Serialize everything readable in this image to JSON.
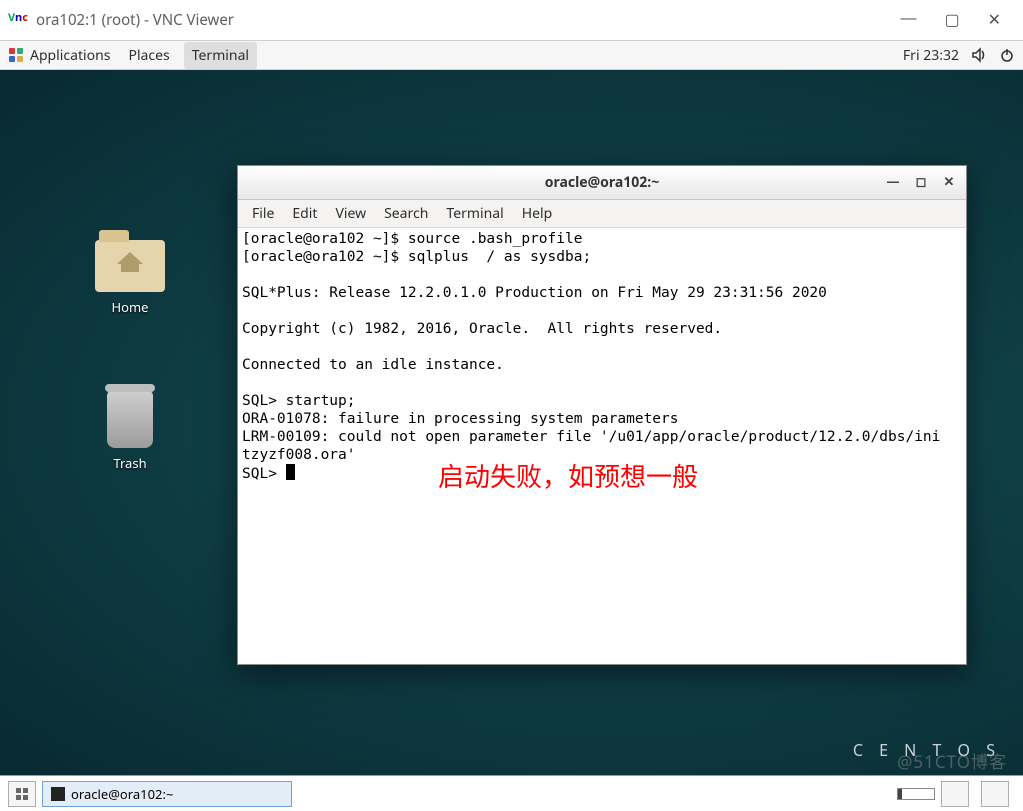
{
  "vnc": {
    "title": "ora102:1 (root) - VNC Viewer"
  },
  "topbar": {
    "applications": "Applications",
    "places": "Places",
    "terminal": "Terminal",
    "clock": "Fri 23:32"
  },
  "desktop": {
    "home_label": "Home",
    "trash_label": "Trash",
    "centos": "C E N T O S"
  },
  "termwin": {
    "title": "oracle@ora102:~",
    "menu": {
      "file": "File",
      "edit": "Edit",
      "view": "View",
      "search": "Search",
      "terminal": "Terminal",
      "help": "Help"
    }
  },
  "terminal_lines": [
    "[oracle@ora102 ~]$ source .bash_profile",
    "[oracle@ora102 ~]$ sqlplus  / as sysdba;",
    "",
    "SQL*Plus: Release 12.2.0.1.0 Production on Fri May 29 23:31:56 2020",
    "",
    "Copyright (c) 1982, 2016, Oracle.  All rights reserved.",
    "",
    "Connected to an idle instance.",
    "",
    "SQL> startup;",
    "ORA-01078: failure in processing system parameters",
    "LRM-00109: could not open parameter file '/u01/app/oracle/product/12.2.0/dbs/ini",
    "tzyzf008.ora'",
    "SQL> "
  ],
  "annotation": "启动失败，如预想一般",
  "taskbar": {
    "active_task": "oracle@ora102:~"
  },
  "watermark": "@51CTO博客"
}
